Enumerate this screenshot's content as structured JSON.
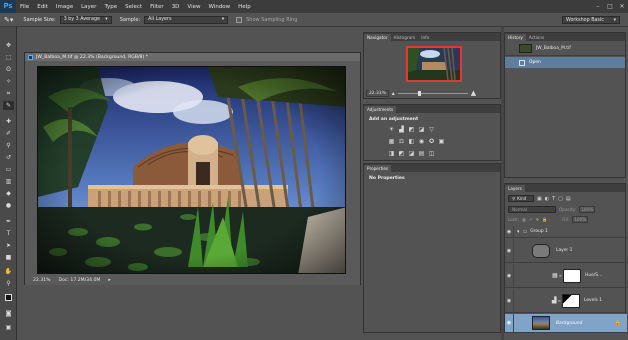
{
  "app": {
    "logo": "Ps",
    "menu": [
      "File",
      "Edit",
      "Image",
      "Layer",
      "Type",
      "Select",
      "Filter",
      "3D",
      "View",
      "Window",
      "Help"
    ]
  },
  "window_controls": {
    "minimize": "–",
    "maximize": "□",
    "close": "✕"
  },
  "options": {
    "sample_size_label": "Sample Size:",
    "sample_size_value": "3 by 3 Average",
    "sample_label": "Sample:",
    "sample_value": "All Layers",
    "show_ring_label": "Show Sampling Ring",
    "workspace": "Workshop Basic"
  },
  "document": {
    "tab_title": "JW_Balboa_M.tif @ 22.3% (Background, RGB/8) *",
    "zoom": "22.31%",
    "doc_info": "Doc: 17.2M/34.0M"
  },
  "navigator": {
    "tabs": [
      "Navigator",
      "Histogram",
      "Info"
    ],
    "zoom": "22.31%"
  },
  "adjustments": {
    "tab": "Adjustments",
    "heading": "Add an adjustment"
  },
  "properties": {
    "tab": "Properties",
    "text": "No Properties"
  },
  "history": {
    "tabs": [
      "History",
      "Actions"
    ],
    "snapshot": "JW_Balboa_M.tif",
    "state": "Open"
  },
  "layers": {
    "tab": "Layers",
    "kind": "Kind",
    "blend": "Normal",
    "opacity_label": "Opacity:",
    "opacity_value": "100%",
    "lock_label": "Lock:",
    "fill_label": "Fill:",
    "fill_value": "100%",
    "items": [
      {
        "name": "Group 1"
      },
      {
        "name": "Layer 1"
      },
      {
        "name": "Hue/S..."
      },
      {
        "name": "Levels 1"
      },
      {
        "name": "Background"
      }
    ]
  },
  "colors": {
    "accent_selected": "#7fa4c8",
    "history_selected": "#5f7e9e"
  }
}
